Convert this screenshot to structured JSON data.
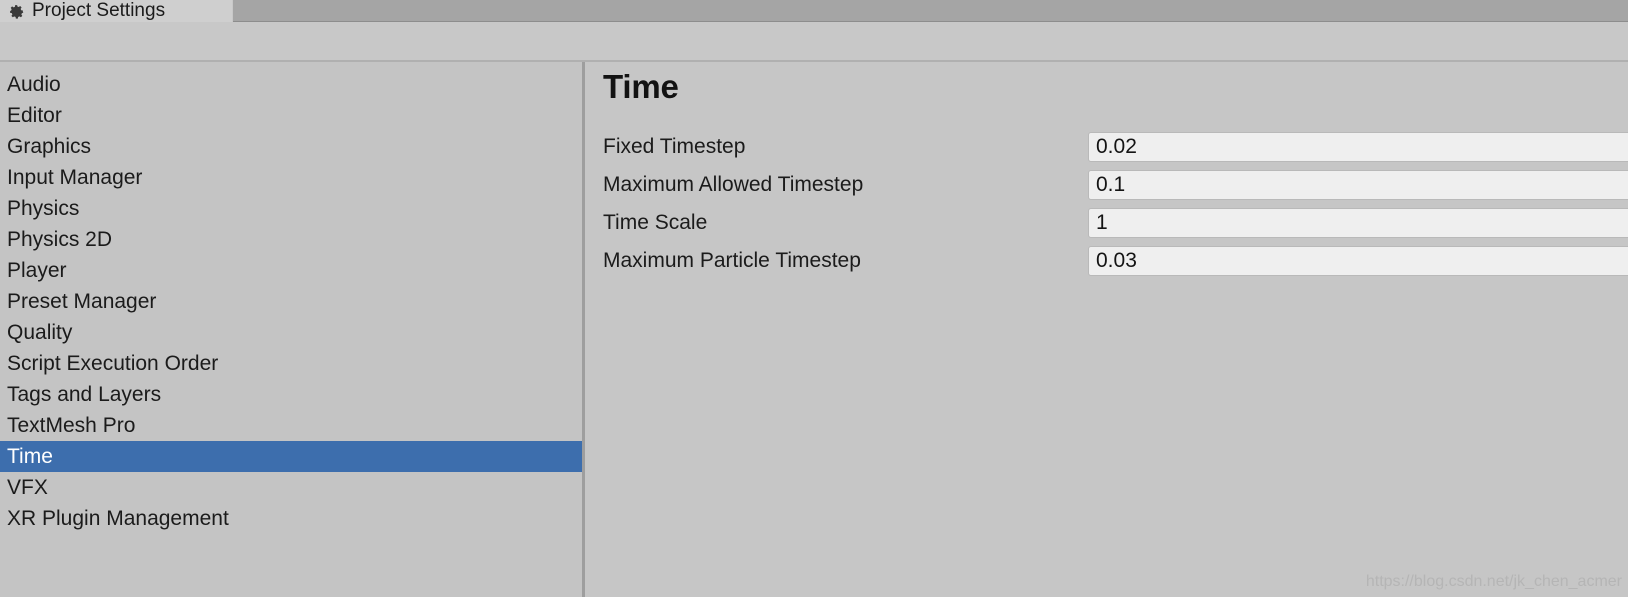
{
  "window": {
    "tab_label": "Project Settings",
    "gear_icon": "gear-icon"
  },
  "sidebar": {
    "items": [
      {
        "label": "Audio",
        "selected": false
      },
      {
        "label": "Editor",
        "selected": false
      },
      {
        "label": "Graphics",
        "selected": false
      },
      {
        "label": "Input Manager",
        "selected": false
      },
      {
        "label": "Physics",
        "selected": false
      },
      {
        "label": "Physics 2D",
        "selected": false
      },
      {
        "label": "Player",
        "selected": false
      },
      {
        "label": "Preset Manager",
        "selected": false
      },
      {
        "label": "Quality",
        "selected": false
      },
      {
        "label": "Script Execution Order",
        "selected": false
      },
      {
        "label": "Tags and Layers",
        "selected": false
      },
      {
        "label": "TextMesh Pro",
        "selected": false
      },
      {
        "label": "Time",
        "selected": true
      },
      {
        "label": "VFX",
        "selected": false
      },
      {
        "label": "XR Plugin Management",
        "selected": false
      }
    ],
    "selected_color": "#3d6ead"
  },
  "content": {
    "title": "Time",
    "fields": [
      {
        "label": "Fixed Timestep",
        "value": "0.02"
      },
      {
        "label": "Maximum Allowed Timestep",
        "value": "0.1"
      },
      {
        "label": "Time Scale",
        "value": "1"
      },
      {
        "label": "Maximum Particle Timestep",
        "value": "0.03"
      }
    ]
  },
  "watermark": {
    "text": "https://blog.csdn.net/jk_chen_acmer"
  }
}
